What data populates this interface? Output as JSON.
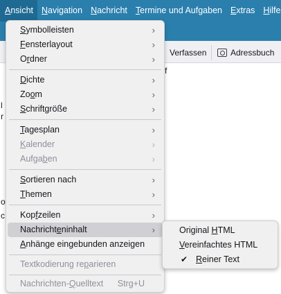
{
  "menubar": {
    "items": [
      {
        "pre": "",
        "acc": "A",
        "post": "nsicht"
      },
      {
        "pre": "",
        "acc": "N",
        "post": "avigation"
      },
      {
        "pre": "",
        "acc": "N",
        "post": "achricht"
      },
      {
        "pre": "",
        "acc": "T",
        "post": "ermine und Aufgaben"
      },
      {
        "pre": "",
        "acc": "E",
        "post": "xtras"
      },
      {
        "pre": "",
        "acc": "H",
        "post": "ilfe"
      }
    ]
  },
  "toolbar": {
    "compose_label": "Verfassen",
    "addressbook_label": "Adressbuch"
  },
  "background_fragments": [
    "f",
    "l",
    "r",
    "o",
    "c"
  ],
  "view_menu": {
    "items": [
      {
        "pre": "",
        "acc": "S",
        "post": "ymbolleisten",
        "submenu": true,
        "disabled": false
      },
      {
        "pre": "",
        "acc": "F",
        "post": "ensterlayout",
        "submenu": true,
        "disabled": false
      },
      {
        "pre": "O",
        "acc": "r",
        "post": "dner",
        "submenu": true,
        "disabled": false
      },
      {
        "pre": "",
        "acc": "D",
        "post": "ichte",
        "submenu": true,
        "disabled": false
      },
      {
        "pre": "Zo",
        "acc": "o",
        "post": "m",
        "submenu": true,
        "disabled": false
      },
      {
        "pre": "",
        "acc": "S",
        "post": "chriftgröße",
        "submenu": true,
        "disabled": false
      },
      {
        "pre": "",
        "acc": "T",
        "post": "agesplan",
        "submenu": true,
        "disabled": false
      },
      {
        "pre": "",
        "acc": "K",
        "post": "alender",
        "submenu": true,
        "disabled": true
      },
      {
        "pre": "Aufga",
        "acc": "b",
        "post": "en",
        "submenu": true,
        "disabled": true
      },
      {
        "pre": "",
        "acc": "S",
        "post": "ortieren nach",
        "submenu": true,
        "disabled": false
      },
      {
        "pre": "",
        "acc": "T",
        "post": "hemen",
        "submenu": true,
        "disabled": false
      },
      {
        "pre": "Kop",
        "acc": "f",
        "post": "zeilen",
        "submenu": true,
        "disabled": false
      },
      {
        "pre": "Nachricht",
        "acc": "e",
        "post": "ninhalt",
        "submenu": true,
        "disabled": false,
        "highlighted": true
      },
      {
        "pre": "",
        "acc": "A",
        "post": "nhänge eingebunden anzeigen",
        "submenu": false,
        "disabled": false
      },
      {
        "pre": "Textkodierung re",
        "acc": "p",
        "post": "arieren",
        "submenu": false,
        "disabled": true
      },
      {
        "pre": "Nachrichten-",
        "acc": "Q",
        "post": "uelltext",
        "submenu": false,
        "disabled": true,
        "shortcut": "Strg+U"
      }
    ]
  },
  "message_body_submenu": {
    "items": [
      {
        "pre": "Original ",
        "acc": "H",
        "post": "TML",
        "checked": false
      },
      {
        "pre": "",
        "acc": "V",
        "post": "ereinfachtes HTML",
        "checked": false
      },
      {
        "pre": "",
        "acc": "R",
        "post": "einer Text",
        "checked": true
      }
    ]
  },
  "icons": {
    "submenu_arrow": "chevron-right-icon",
    "check": "checkmark-icon",
    "addressbook": "addressbook-icon"
  },
  "colors": {
    "menubar_bg": "#2a7fad",
    "menu_bg": "#f0f0f0",
    "highlight": "#d0d0d4",
    "disabled_text": "#8f8f9d"
  }
}
